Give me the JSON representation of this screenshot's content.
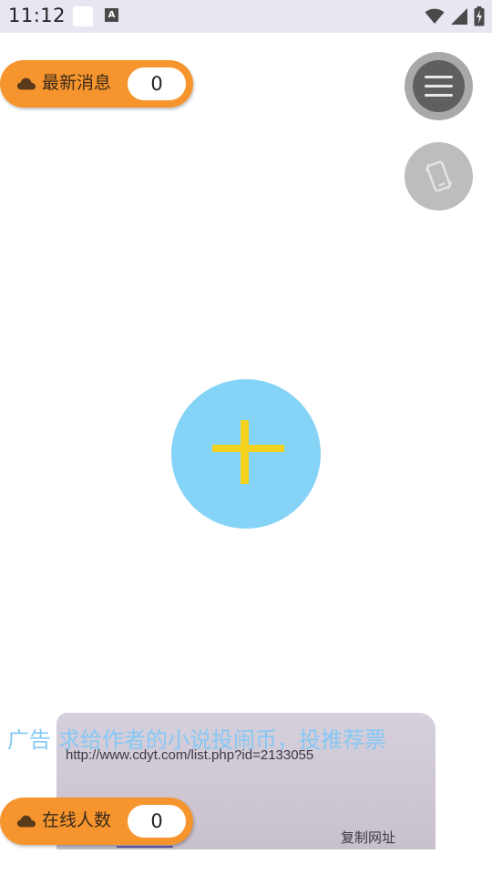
{
  "status_bar": {
    "time": "11:12",
    "a_icon_letter": "A"
  },
  "news_pill": {
    "label": "最新消息",
    "count": "0"
  },
  "online_pill": {
    "label": "在线人数",
    "count": "0"
  },
  "ad": {
    "label": "广告",
    "text": "求给作者的小说投闹币，投推荐票",
    "url": "http://www.cdyt.com/list.php?id=2133055",
    "copy_button": "复制网址"
  },
  "colors": {
    "pill": "#f6952d",
    "add_fab": "#86d3f8",
    "add_fab_cross": "#f5d21e",
    "menu_fab": "#5f5f5f",
    "ad_text": "#86c8f4"
  },
  "icons": {
    "status": [
      "square-notification-icon",
      "a-badge-icon",
      "wifi-icon",
      "signal-icon",
      "battery-charging-icon"
    ],
    "pill": "cloud-icon",
    "menu": "hamburger-menu-icon",
    "rotate": "screen-rotate-icon",
    "add": "plus-icon"
  }
}
